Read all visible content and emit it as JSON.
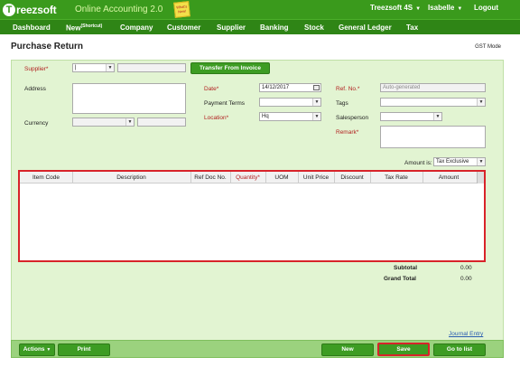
{
  "app": {
    "logo_letter": "T",
    "logo_text": "reezsoft",
    "subtitle": "Online Accounting 2.0",
    "whats_new": "What's New!",
    "org": "Treezsoft 4S",
    "user": "Isabelle",
    "logout": "Logout"
  },
  "nav": {
    "items": [
      "Dashboard",
      "New",
      "Company",
      "Customer",
      "Supplier",
      "Banking",
      "Stock",
      "General Ledger",
      "Tax"
    ],
    "new_suffix": "(Shortcut)"
  },
  "page": {
    "title": "Purchase Return",
    "gst_mode": "GST Mode"
  },
  "form": {
    "supplier_label": "Supplier*",
    "transfer_btn": "Transfer From Invoice",
    "address_label": "Address",
    "currency_label": "Currency",
    "date_label": "Date*",
    "date_value": "14/12/2017",
    "payment_terms_label": "Payment Terms",
    "location_label": "Location*",
    "location_value": "Hq",
    "ref_label": "Ref. No.*",
    "ref_value": "Auto-generated",
    "tags_label": "Tags",
    "salesperson_label": "Salesperson",
    "remark_label": "Remark*",
    "amount_is_label": "Amount is:",
    "amount_is_value": "Tax Exclusive"
  },
  "table": {
    "columns": [
      "Item Code",
      "Description",
      "Ref Doc No.",
      "Quantity*",
      "UOM",
      "Unit Price",
      "Discount",
      "Tax Rate",
      "Amount"
    ]
  },
  "totals": {
    "subtotal_label": "Subtotal",
    "subtotal_value": "0.00",
    "grand_total_label": "Grand Total",
    "grand_total_value": "0.00",
    "journal_entry": "Journal Entry"
  },
  "footer": {
    "actions": "Actions",
    "print": "Print",
    "new": "New",
    "save": "Save",
    "goto_list": "Go to list"
  }
}
